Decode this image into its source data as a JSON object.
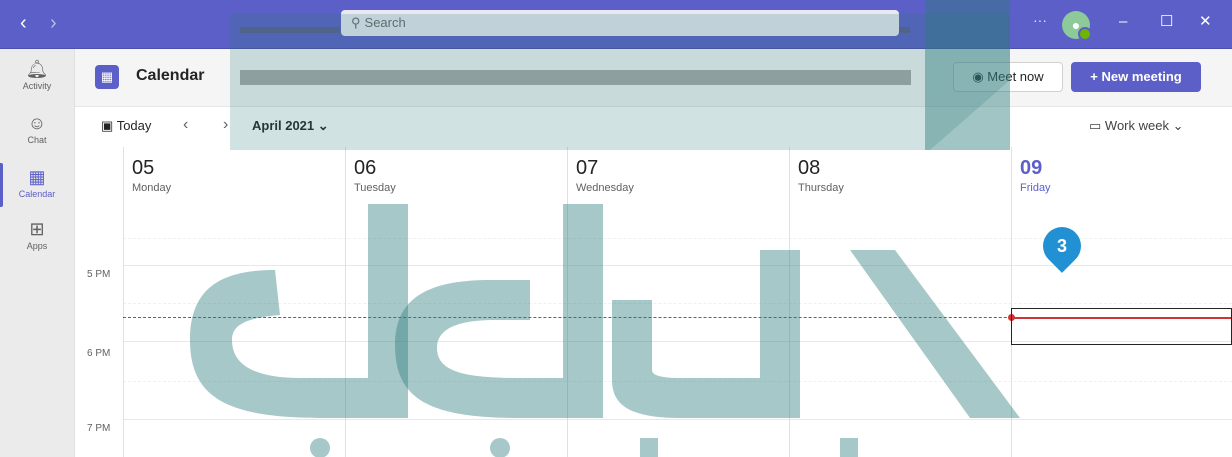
{
  "titlebar": {
    "search_placeholder": "Search",
    "more_label": "···",
    "minimize": "–",
    "maximize": "☐",
    "close": "✕"
  },
  "rail": {
    "items": [
      {
        "label": "Activity",
        "icon": "bell-icon"
      },
      {
        "label": "Chat",
        "icon": "chat-icon"
      },
      {
        "label": "Calendar",
        "icon": "calendar-icon"
      },
      {
        "label": "Apps",
        "icon": "apps-icon"
      }
    ]
  },
  "calendar": {
    "title": "Calendar",
    "meet_now": "Meet now",
    "new_meeting": "New meeting",
    "today": "Today",
    "month": "April 2021",
    "view": "Work week",
    "days": [
      {
        "num": "05",
        "name": "Monday"
      },
      {
        "num": "06",
        "name": "Tuesday"
      },
      {
        "num": "07",
        "name": "Wednesday"
      },
      {
        "num": "08",
        "name": "Thursday"
      },
      {
        "num": "09",
        "name": "Friday"
      }
    ],
    "times": [
      "5 PM",
      "6 PM",
      "7 PM"
    ]
  },
  "callout_number": "3",
  "colors": {
    "accent": "#5b5fc7",
    "now_line": "#d13438",
    "callout": "#2191d4",
    "watermark": "#2e7d7c"
  }
}
